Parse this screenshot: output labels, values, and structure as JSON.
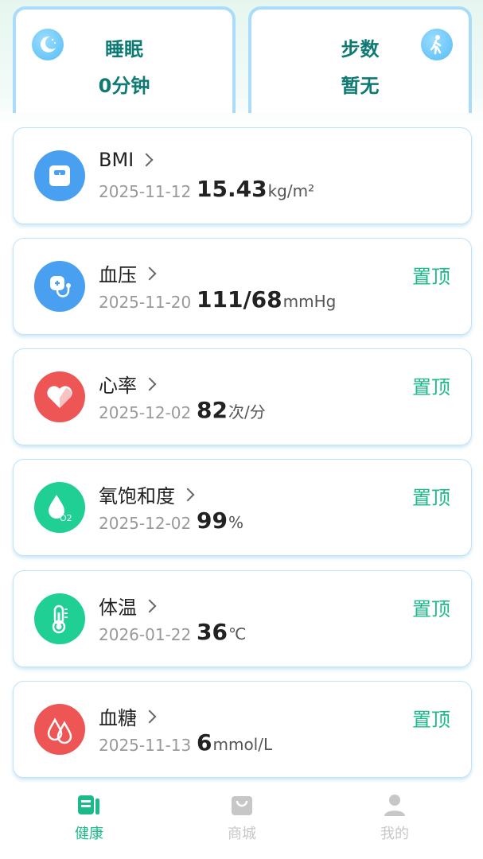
{
  "summary": {
    "sleep": {
      "title": "睡眠",
      "value": "0分钟",
      "icon": "moon-icon"
    },
    "steps": {
      "title": "步数",
      "value": "暂无",
      "icon": "walking-icon"
    }
  },
  "pin_label": "置顶",
  "metrics": [
    {
      "name": "BMI",
      "date": "2025-11-12",
      "value": "15.43",
      "unit": "kg/m²",
      "icon": "scale-icon",
      "color": "#4aa0f0"
    },
    {
      "name": "血压",
      "date": "2025-11-20",
      "value": "111/68",
      "unit": "mmHg",
      "icon": "blood-pressure-icon",
      "color": "#4aa0f0"
    },
    {
      "name": "心率",
      "date": "2025-12-02",
      "value": "82",
      "unit": "次/分",
      "icon": "heart-icon",
      "color": "#ee5656"
    },
    {
      "name": "氧饱和度",
      "date": "2025-12-02",
      "value": "99",
      "unit": "%",
      "icon": "oxygen-drop-icon",
      "color": "#1fcf93"
    },
    {
      "name": "体温",
      "date": "2026-01-22",
      "value": "36",
      "unit": "℃",
      "icon": "thermometer-icon",
      "color": "#1fcf93"
    },
    {
      "name": "血糖",
      "date": "2025-11-13",
      "value": "6",
      "unit": "mmol/L",
      "icon": "blood-drops-icon",
      "color": "#ee5656"
    }
  ],
  "tabs": {
    "health": {
      "label": "健康",
      "icon": "health-report-icon",
      "color": "#1cb98a"
    },
    "mall": {
      "label": "商城",
      "icon": "shopping-bag-icon",
      "color": "#c7c7c7"
    },
    "mine": {
      "label": "我的",
      "icon": "user-icon",
      "color": "#c7c7c7"
    }
  },
  "o2_badge": "O2"
}
